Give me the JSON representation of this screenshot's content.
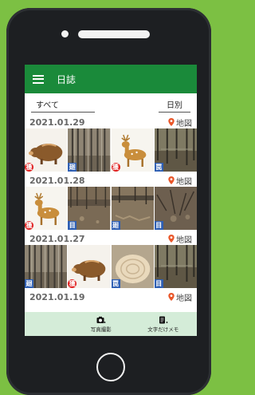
{
  "app": {
    "title": "日誌"
  },
  "filter": {
    "category": "すべて",
    "view": "日別"
  },
  "map_label": "地図",
  "days": [
    {
      "date": "2021.01.29",
      "photos": [
        {
          "kind": "boar",
          "badge": "獲",
          "badge_color": "red"
        },
        {
          "kind": "trees",
          "badge": "廻",
          "badge_color": "blue"
        },
        {
          "kind": "deer",
          "badge": "獲",
          "badge_color": "red"
        },
        {
          "kind": "trees2",
          "badge": "罠",
          "badge_color": "blue"
        }
      ]
    },
    {
      "date": "2021.01.28",
      "photos": [
        {
          "kind": "deer",
          "badge": "獲",
          "badge_color": "red"
        },
        {
          "kind": "ground",
          "badge": "目",
          "badge_color": "blue"
        },
        {
          "kind": "ground2",
          "badge": "廻",
          "badge_color": "blue"
        },
        {
          "kind": "ground3",
          "badge": "目",
          "badge_color": "blue"
        }
      ]
    },
    {
      "date": "2021.01.27",
      "photos": [
        {
          "kind": "trees",
          "badge": "廻",
          "badge_color": "blue"
        },
        {
          "kind": "boar",
          "badge": "獲",
          "badge_color": "red"
        },
        {
          "kind": "stump",
          "badge": "罠",
          "badge_color": "blue"
        },
        {
          "kind": "trees2",
          "badge": "目",
          "badge_color": "blue"
        }
      ]
    },
    {
      "date": "2021.01.19",
      "photos": []
    }
  ],
  "bottom": {
    "photo_label": "写真撮影",
    "memo_label": "文字だけメモ"
  },
  "colors": {
    "appbar": "#1a8a3a",
    "bottombar": "#d4ecd8",
    "pin": "#e9572a"
  }
}
